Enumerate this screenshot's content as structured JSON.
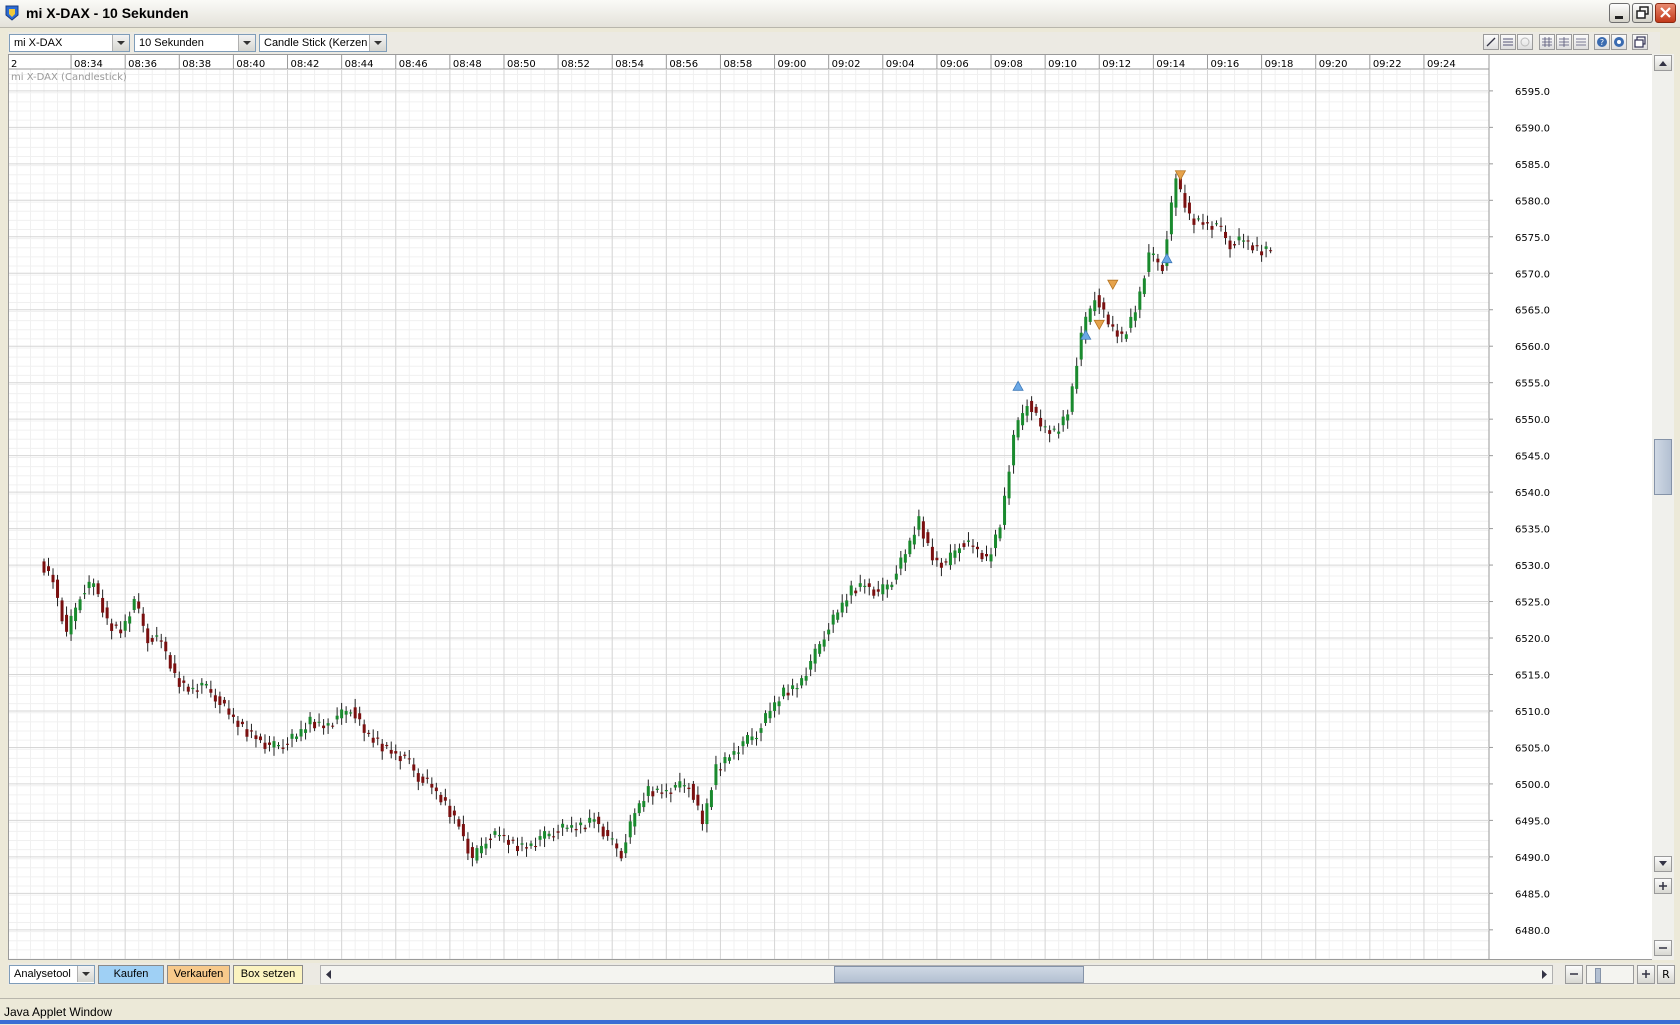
{
  "window": {
    "title": "mi X-DAX - 10 Sekunden"
  },
  "toolbar": {
    "instrument": "mi X-DAX",
    "interval": "10 Sekunden",
    "chart_type": "Candle Stick (Kerzen"
  },
  "chart": {
    "series_label": "mi X-DAX (Candlestick)",
    "left_edge_tick": "2"
  },
  "bottom": {
    "analysetool": "Analysetool",
    "kaufen": "Kaufen",
    "verkaufen": "Verkaufen",
    "box_setzen": "Box setzen",
    "reset": "R"
  },
  "status": {
    "text": "Java Applet Window"
  },
  "colors": {
    "up": "#1a8a2e",
    "down": "#7a1010",
    "buy_marker": "#6aa8e6",
    "sell_marker": "#e6a34c",
    "kaufen_bg": "#9fd0f5",
    "verkaufen_bg": "#f7c98b",
    "box_bg": "#fbf3c0"
  },
  "chart_data": {
    "type": "candlestick",
    "title": "mi X-DAX (Candlestick)",
    "x_ticks": [
      "08:34",
      "08:36",
      "08:38",
      "08:40",
      "08:42",
      "08:44",
      "08:46",
      "08:48",
      "08:50",
      "08:52",
      "08:54",
      "08:56",
      "08:58",
      "09:00",
      "09:02",
      "09:04",
      "09:06",
      "09:08",
      "09:10",
      "09:12",
      "09:14",
      "09:16",
      "09:18",
      "09:20",
      "09:22",
      "09:24"
    ],
    "y_ticks": [
      6595.0,
      6590.0,
      6585.0,
      6580.0,
      6575.0,
      6570.0,
      6565.0,
      6560.0,
      6555.0,
      6550.0,
      6545.0,
      6540.0,
      6535.0,
      6530.0,
      6525.0,
      6520.0,
      6515.0,
      6510.0,
      6505.0,
      6500.0,
      6495.0,
      6490.0,
      6485.0,
      6480.0
    ],
    "ylim": [
      6476.0,
      6598.0
    ],
    "time_range": [
      "08:33:00",
      "09:25:00"
    ],
    "grid": true,
    "series": [
      {
        "name": "mi X-DAX",
        "close": [
          [
            "08:33:00",
            6530.5
          ],
          [
            "08:33:30",
            6528.0
          ],
          [
            "08:34:00",
            6520.5
          ],
          [
            "08:34:30",
            6526.0
          ],
          [
            "08:35:00",
            6527.5
          ],
          [
            "08:35:30",
            6522.0
          ],
          [
            "08:36:00",
            6521.0
          ],
          [
            "08:36:30",
            6525.0
          ],
          [
            "08:37:00",
            6520.0
          ],
          [
            "08:37:30",
            6519.5
          ],
          [
            "08:38:00",
            6514.5
          ],
          [
            "08:38:30",
            6513.0
          ],
          [
            "08:39:00",
            6513.5
          ],
          [
            "08:39:30",
            6512.0
          ],
          [
            "08:40:00",
            6509.5
          ],
          [
            "08:40:30",
            6507.5
          ],
          [
            "08:41:00",
            6506.5
          ],
          [
            "08:41:30",
            6505.0
          ],
          [
            "08:42:00",
            6505.5
          ],
          [
            "08:42:30",
            6506.5
          ],
          [
            "08:43:00",
            6508.5
          ],
          [
            "08:43:30",
            6508.0
          ],
          [
            "08:44:00",
            6509.0
          ],
          [
            "08:44:30",
            6510.5
          ],
          [
            "08:45:00",
            6507.0
          ],
          [
            "08:45:30",
            6505.5
          ],
          [
            "08:46:00",
            6504.5
          ],
          [
            "08:46:30",
            6503.5
          ],
          [
            "08:47:00",
            6501.0
          ],
          [
            "08:47:30",
            6499.5
          ],
          [
            "08:48:00",
            6497.0
          ],
          [
            "08:48:30",
            6494.5
          ],
          [
            "08:49:00",
            6489.5
          ],
          [
            "08:49:30",
            6492.5
          ],
          [
            "08:50:00",
            6493.0
          ],
          [
            "08:50:30",
            6491.5
          ],
          [
            "08:51:00",
            6491.5
          ],
          [
            "08:51:30",
            6492.5
          ],
          [
            "08:52:00",
            6493.5
          ],
          [
            "08:52:30",
            6494.0
          ],
          [
            "08:53:00",
            6494.0
          ],
          [
            "08:53:30",
            6495.5
          ],
          [
            "08:54:00",
            6492.5
          ],
          [
            "08:54:30",
            6490.5
          ],
          [
            "08:55:00",
            6496.0
          ],
          [
            "08:55:30",
            6499.0
          ],
          [
            "08:56:00",
            6499.0
          ],
          [
            "08:56:30",
            6499.5
          ],
          [
            "08:57:00",
            6500.0
          ],
          [
            "08:57:30",
            6494.5
          ],
          [
            "08:58:00",
            6502.0
          ],
          [
            "08:58:30",
            6504.0
          ],
          [
            "08:59:00",
            6505.5
          ],
          [
            "08:59:30",
            6507.0
          ],
          [
            "09:00:00",
            6510.0
          ],
          [
            "09:00:30",
            6512.5
          ],
          [
            "09:01:00",
            6513.5
          ],
          [
            "09:01:30",
            6516.5
          ],
          [
            "09:02:00",
            6520.5
          ],
          [
            "09:02:30",
            6523.5
          ],
          [
            "09:03:00",
            6526.5
          ],
          [
            "09:03:30",
            6527.5
          ],
          [
            "09:04:00",
            6526.0
          ],
          [
            "09:04:30",
            6528.0
          ],
          [
            "09:05:00",
            6531.5
          ],
          [
            "09:05:30",
            6536.0
          ],
          [
            "09:06:00",
            6531.0
          ],
          [
            "09:06:30",
            6530.0
          ],
          [
            "09:07:00",
            6533.0
          ],
          [
            "09:07:30",
            6532.5
          ],
          [
            "09:08:00",
            6530.5
          ],
          [
            "09:08:30",
            6535.5
          ],
          [
            "09:09:00",
            6547.5
          ],
          [
            "09:09:30",
            6552.5
          ],
          [
            "09:10:00",
            6549.0
          ],
          [
            "09:10:30",
            6548.0
          ],
          [
            "09:11:00",
            6551.0
          ],
          [
            "09:11:30",
            6561.5
          ],
          [
            "09:12:00",
            6567.0
          ],
          [
            "09:12:30",
            6563.0
          ],
          [
            "09:13:00",
            6561.0
          ],
          [
            "09:13:30",
            6565.0
          ],
          [
            "09:14:00",
            6572.5
          ],
          [
            "09:14:30",
            6571.0
          ],
          [
            "09:15:00",
            6583.0
          ],
          [
            "09:15:30",
            6577.5
          ],
          [
            "09:16:00",
            6577.0
          ],
          [
            "09:16:30",
            6576.5
          ],
          [
            "09:17:00",
            6574.0
          ],
          [
            "09:17:30",
            6574.5
          ],
          [
            "09:18:00",
            6573.0
          ],
          [
            "09:18:30",
            6573.5
          ]
        ]
      }
    ],
    "signals": [
      {
        "type": "buy",
        "time": "09:09:00",
        "price": 6554.5
      },
      {
        "type": "buy",
        "time": "09:11:30",
        "price": 6561.5
      },
      {
        "type": "sell",
        "time": "09:12:00",
        "price": 6563.0
      },
      {
        "type": "sell",
        "time": "09:12:30",
        "price": 6568.5
      },
      {
        "type": "buy",
        "time": "09:14:30",
        "price": 6572.0
      },
      {
        "type": "sell",
        "time": "09:15:00",
        "price": 6583.5
      }
    ]
  }
}
